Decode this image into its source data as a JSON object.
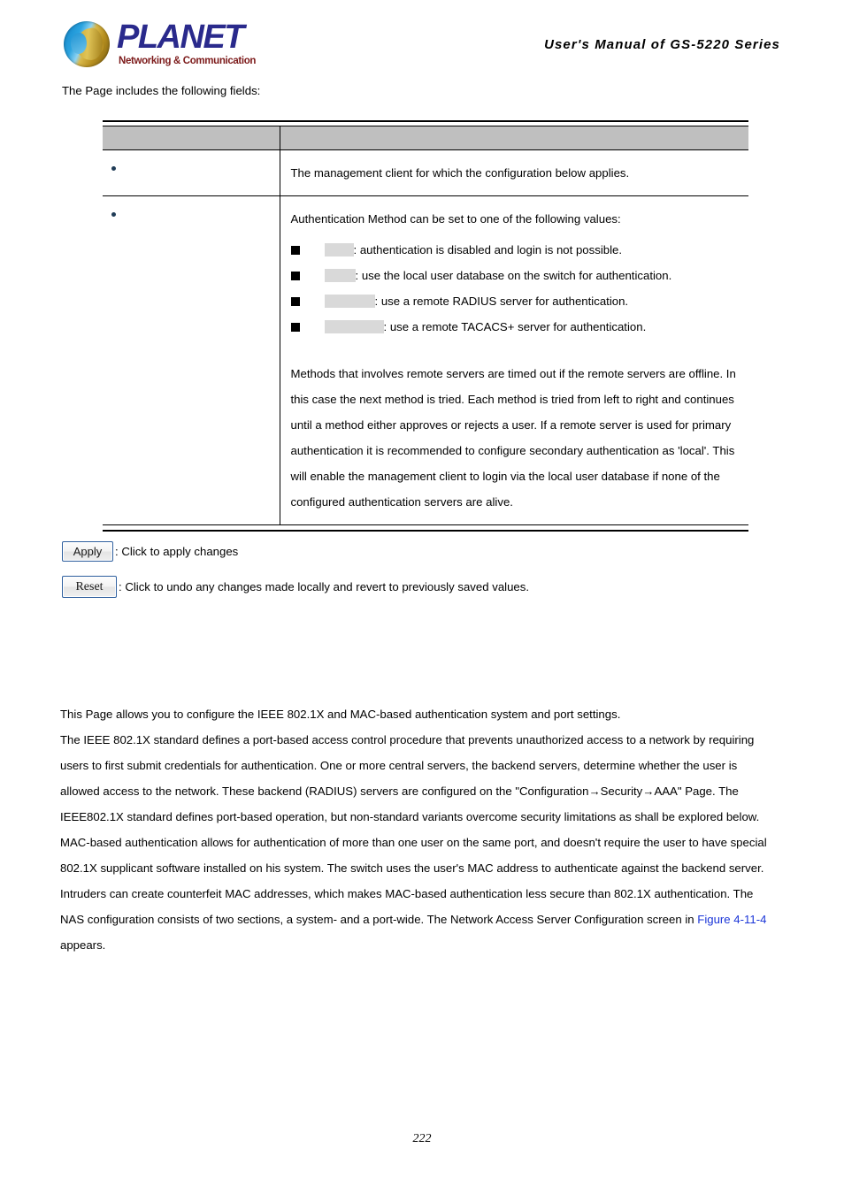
{
  "header": {
    "logo_word": "PLANET",
    "logo_tagline": "Networking & Communication",
    "manual_title": "User's Manual of GS-5220 Series"
  },
  "intro": {
    "text": "The Page includes the following fields:"
  },
  "fields_table": {
    "columns": {
      "object": "",
      "description": ""
    },
    "rows": [
      {
        "object": "",
        "description": "The management client for which the configuration below applies."
      },
      {
        "object": "",
        "description": "Authentication Method can be set to one of the following values:",
        "enum_items": [
          {
            "term": "",
            "text": ": authentication is disabled and login is not possible."
          },
          {
            "term": "",
            "text": ": use the local user database on the switch for authentication."
          },
          {
            "term": "",
            "text": ": use a remote RADIUS server for authentication."
          },
          {
            "term": "",
            "text": ": use a remote TACACS+ server for authentication."
          }
        ],
        "note": "Methods that involves remote servers are timed out if the remote servers are offline. In this case the next method is tried. Each method is tried from left to right and continues until a method either approves or rejects a user. If a remote server is used for primary authentication it is recommended to configure secondary authentication as 'local'. This will enable the management client to login via the local user database if none of the configured authentication servers are alive."
      }
    ]
  },
  "buttons": {
    "apply_label": "Apply",
    "apply_caption": ": Click to apply changes",
    "reset_label": "Reset",
    "reset_caption": ": Click to undo any changes made locally and revert to previously saved values."
  },
  "body": {
    "para1": "This Page allows you to configure the IEEE 802.1X and MAC-based authentication system and port settings.",
    "para2_before": "The IEEE 802.1X standard defines a port-based access control procedure that prevents unauthorized access to a network by requiring users to first submit credentials for authentication. One or more central servers, the backend servers, determine whether the user is allowed access to the network. These backend (RADIUS) servers are configured on the \"Configuration→Security→AAA\" Page. The IEEE802.1X standard defines port-based operation, but non-standard variants overcome security limitations as shall be explored below.",
    "para3_before": "MAC-based authentication allows for authentication of more than one user on the same port, and doesn't require the user to have special 802.1X supplicant software installed on his system. The switch uses the user's MAC address to authenticate against the backend server. Intruders can create counterfeit MAC addresses, which makes MAC-based authentication less secure than 802.1X authentication. The NAS configuration consists of two sections, a system- and a port-wide. The Network Access Server Configuration screen in ",
    "figure_link": "Figure 4-11-4",
    "para3_after": " appears."
  },
  "footer": {
    "page_number": "222"
  },
  "colors": {
    "link": "#1a35d8",
    "table_header_bg": "#bfbfbf",
    "bullet": "#1f3b56",
    "term_highlight": "#d9d9d9",
    "logo_blue": "#2a2a8c",
    "logo_red": "#7c1a1a"
  }
}
